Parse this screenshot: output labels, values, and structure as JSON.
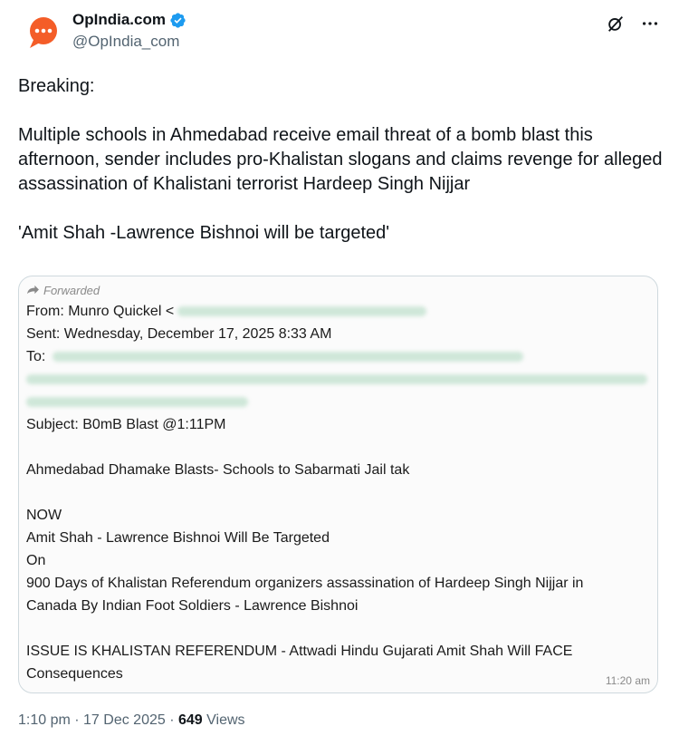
{
  "account": {
    "display_name": "OpIndia.com",
    "handle": "@OpIndia_com",
    "verified_color": "#1d9bf0",
    "avatar_color": "#f45d28"
  },
  "tweet": {
    "line1": "Breaking:",
    "line2": "Multiple schools in Ahmedabad receive email threat of a bomb blast this afternoon, sender includes pro-Khalistan slogans and claims revenge for alleged assassination of Khalistani terrorist Hardeep Singh Nijjar",
    "line3": "'Amit Shah -Lawrence Bishnoi will be targeted'"
  },
  "email": {
    "forwarded": "Forwarded",
    "from": "From: Munro Quickel <",
    "sent": "Sent: Wednesday, December 17, 2025 8:33 AM",
    "to": "To:",
    "subject": "Subject: B0mB Blast @1:11PM",
    "body1": "Ahmedabad Dhamake Blasts- Schools to Sabarmati Jail tak",
    "body2": "NOW",
    "body3": "Amit Shah - Lawrence Bishnoi Will Be Targeted",
    "body4": "On",
    "body5": "900 Days of Khalistan Referendum organizers assassination of Hardeep Singh Nijjar in",
    "body6": "Canada By Indian Foot Soldiers - Lawrence Bishnoi",
    "body7": "ISSUE IS KHALISTAN REFERENDUM - Attwadi Hindu Gujarati Amit Shah Will FACE",
    "body8": "Consequences",
    "time": "11:20 am"
  },
  "meta": {
    "time": "1:10 pm",
    "sep1": " · ",
    "date": "17 Dec 2025",
    "sep2": " · ",
    "views_count": "649",
    "views_label": " Views"
  },
  "icons": {
    "grok": "grok-icon",
    "more": "more-icon",
    "verified": "verified-icon",
    "forward": "forward-icon"
  }
}
